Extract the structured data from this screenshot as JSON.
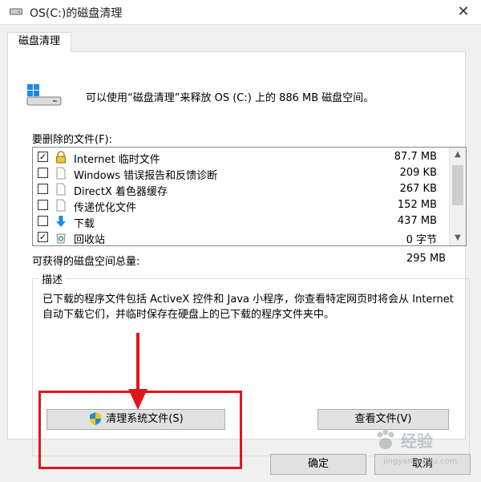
{
  "window": {
    "title": "OS(C:)的磁盘清理",
    "close": "✕"
  },
  "tabs": [
    {
      "label": "磁盘清理"
    }
  ],
  "header": {
    "text": "可以使用“磁盘清理”来释放 OS (C:) 上的 886 MB 磁盘空间。"
  },
  "files_label": "要删除的文件(F):",
  "files": [
    {
      "name": "Internet 临时文件",
      "size": "87.7 MB",
      "checked": "✓",
      "icon": "lock-icon"
    },
    {
      "name": "Windows 错误报告和反馈诊断",
      "size": "209 KB",
      "checked": "",
      "icon": "file-icon"
    },
    {
      "name": "DirectX 着色器缓存",
      "size": "267 KB",
      "checked": "",
      "icon": "file-icon"
    },
    {
      "name": "传递优化文件",
      "size": "152 MB",
      "checked": "",
      "icon": "file-icon"
    },
    {
      "name": "下载",
      "size": "437 MB",
      "checked": "",
      "icon": "download-arrow-icon"
    },
    {
      "name": "回收站",
      "size": "0 字节",
      "checked": "✓",
      "icon": "recycle-bin-icon"
    }
  ],
  "total": {
    "label": "可获得的磁盘空间总量:",
    "value": "295 MB"
  },
  "description": {
    "title": "描述",
    "text": "已下载的程序文件包括 ActiveX 控件和 Java 小程序，你查看特定网页时将会从 Internet 自动下载它们，并临时保存在硬盘上的已下载的程序文件夹中。"
  },
  "buttons": {
    "clean_system": "清理系统文件(S)",
    "view_files": "查看文件(V)",
    "ok": "确定",
    "cancel": "取消"
  },
  "scrollbar": {
    "up": "▲",
    "down": "▼"
  },
  "colors": {
    "highlight": "#e0161c",
    "accent_blue": "#1e88e5"
  },
  "watermark": {
    "text": "经验",
    "url": "jingyan.baidu.com"
  }
}
